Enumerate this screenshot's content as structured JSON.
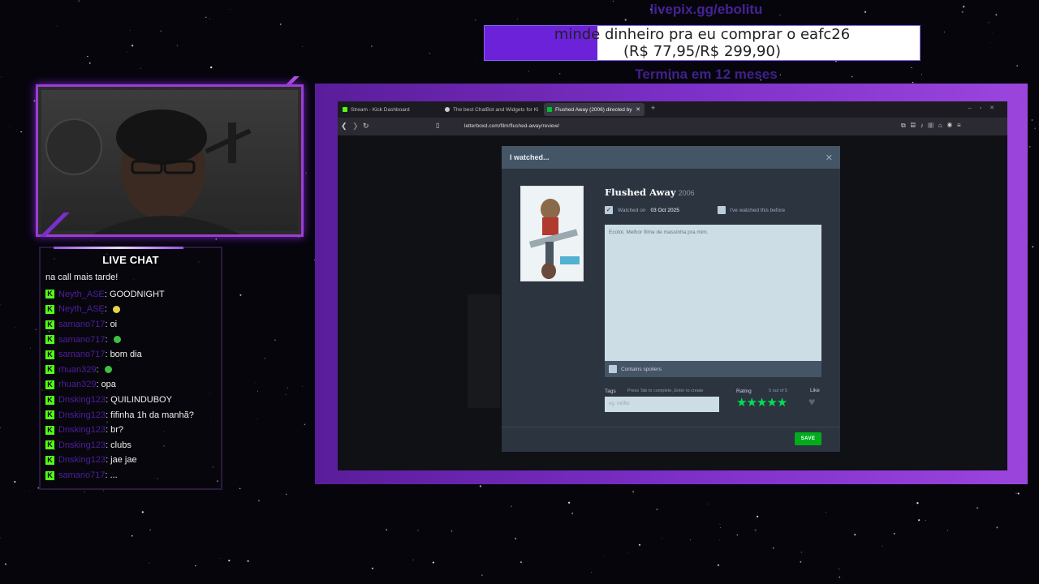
{
  "goal": {
    "url": "livepix.gg/ebolitu",
    "line1": "minde dinheiro pra eu comprar o eafc26",
    "line2": "(R$ 77,95/R$ 299,90)",
    "progress": 0.26,
    "time_left": "Termina em 12 meses",
    "fill_color": "#6b22d9"
  },
  "chat": {
    "title": "LIVE CHAT",
    "first_line": "na call mais tarde!",
    "messages": [
      {
        "user": "Neyth_ASE",
        "text": "GOODNIGHT"
      },
      {
        "user": "Neyth_ASE",
        "text": "",
        "emote": "#e8d34a"
      },
      {
        "user": "samano717",
        "text": "oi"
      },
      {
        "user": "samano717",
        "text": "",
        "emote": "#40c040"
      },
      {
        "user": "samano717",
        "text": "bom dia"
      },
      {
        "user": "rhuan329",
        "text": "",
        "emote": "#40c040"
      },
      {
        "user": "rhuan329",
        "text": "opa"
      },
      {
        "user": "Dnsking123",
        "text": "QUILINDUBOY"
      },
      {
        "user": "Dnsking123",
        "text": "fifinha 1h da manhã?"
      },
      {
        "user": "Dnsking123",
        "text": "br?"
      },
      {
        "user": "Dnsking123",
        "text": "clubs"
      },
      {
        "user": "Dnsking123",
        "text": "jae jae"
      },
      {
        "user": "samano717",
        "text": "..."
      }
    ],
    "badge_color": "#53fc18"
  },
  "browser": {
    "tabs": [
      {
        "label": "Stream - Kick Dashboard",
        "dot": "#53fc18"
      },
      {
        "label": "The best ChatBot and Widgets for Ki",
        "dot": "#cccccc"
      },
      {
        "label": "Flushed Away (2006) directed by",
        "dot": "#00c030"
      }
    ],
    "url": "letterboxd.com/film/flushed-away/review/"
  },
  "modal": {
    "header": "I watched...",
    "film_title": "Flushed Away",
    "film_year": "2006",
    "watched_on_label": "Watched on",
    "watched_on_date": "03 Oct 2025",
    "watched_before_label": "I've watched this before",
    "review_text": "Ecolol. Melhor filme de massinha pra mim.",
    "spoilers_label": "Contains spoilers",
    "tags_label": "Tags",
    "tags_hint": "Press Tab to complete, Enter to create",
    "tags_placeholder": "eg. netflix",
    "rating_label": "Rating",
    "rating_value_text": "5 out of 5",
    "rating": 5,
    "like_label": "Like",
    "save_label": "SAVE",
    "accent_green": "#00e054",
    "save_color": "#00ac1c"
  }
}
